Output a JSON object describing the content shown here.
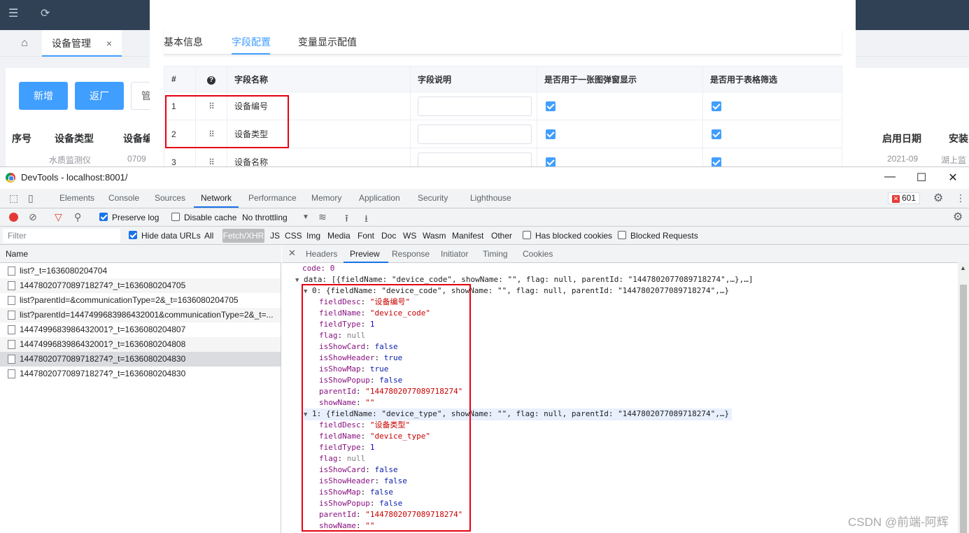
{
  "app": {
    "tab_label": "设备管理",
    "tab_close": "×",
    "buttons": {
      "add": "新增",
      "return": "返厂",
      "manage_partial": "管"
    },
    "columns": {
      "seq": "序号",
      "type": "设备类型",
      "code_partial": "设备编",
      "enable_date": "启用日期",
      "install_partial": "安装"
    },
    "row_partial": {
      "a": "水质监测仪",
      "b": "0709",
      "c": "2021-09",
      "d": "湖上监"
    }
  },
  "modal": {
    "tabs": [
      "基本信息",
      "字段配置",
      "变量显示配值"
    ],
    "active_tab": 1,
    "table": {
      "headers": [
        "#",
        "",
        "字段名称",
        "字段说明",
        "是否用于一张图弹窗显示",
        "是否用于表格筛选"
      ],
      "rows": [
        {
          "index": "1",
          "name": "设备编号"
        },
        {
          "index": "2",
          "name": "设备类型"
        },
        {
          "index": "3",
          "name": "设备名称"
        }
      ]
    }
  },
  "devtools": {
    "title": "DevTools - localhost:8001/",
    "main_tabs": [
      "Elements",
      "Console",
      "Sources",
      "Network",
      "Performance",
      "Memory",
      "Application",
      "Security",
      "Lighthouse"
    ],
    "active_main_tab": "Network",
    "error_count": "601",
    "toolbar": {
      "preserve_log": "Preserve log",
      "disable_cache": "Disable cache",
      "throttling": "No throttling"
    },
    "filter": {
      "placeholder": "Filter",
      "hide_data_urls": "Hide data URLs",
      "types": [
        "All",
        "Fetch/XHR",
        "JS",
        "CSS",
        "Img",
        "Media",
        "Font",
        "Doc",
        "WS",
        "Wasm",
        "Manifest",
        "Other"
      ],
      "active_type": "Fetch/XHR",
      "has_blocked_cookies": "Has blocked cookies",
      "blocked_requests": "Blocked Requests"
    },
    "name_header": "Name",
    "requests": [
      "list?_t=1636080204704",
      "1447802077089718274?_t=1636080204705",
      "list?parentId=&communicationType=2&_t=1636080204705",
      "list?parentId=1447499683986432001&communicationType=2&_t=...",
      "1447499683986432001?_t=1636080204807",
      "1447499683986432001?_t=1636080204808",
      "1447802077089718274?_t=1636080204830",
      "1447802077089718274?_t=1636080204830"
    ],
    "selected_request": 6,
    "detail_tabs": [
      "Headers",
      "Preview",
      "Response",
      "Initiator",
      "Timing",
      "Cookies"
    ],
    "active_detail_tab": "Preview",
    "preview": {
      "code_line": "code: 0",
      "data_line": "data: [{fieldName: \"device_code\", showName: \"\", flag: null, parentId: \"1447802077089718274\",…},…]",
      "items": [
        {
          "summary": "0: {fieldName: \"device_code\", showName: \"\", flag: null, parentId: \"1447802077089718274\",…}",
          "fieldDesc": "\"设备编号\"",
          "fieldName": "\"device_code\"",
          "fieldType": "1",
          "flag": "null",
          "isShowCard": "false",
          "isShowHeader": "true",
          "isShowMap": "true",
          "isShowPopup": "false",
          "parentId": "\"1447802077089718274\"",
          "showName": "\"\""
        },
        {
          "summary": "1: {fieldName: \"device_type\", showName: \"\", flag: null, parentId: \"1447802077089718274\",…}",
          "fieldDesc": "\"设备类型\"",
          "fieldName": "\"device_type\"",
          "fieldType": "1",
          "flag": "null",
          "isShowCard": "false",
          "isShowHeader": "false",
          "isShowMap": "false",
          "isShowPopup": "false",
          "parentId": "\"1447802077089718274\"",
          "showName": "\"\""
        }
      ]
    }
  },
  "watermark": "CSDN @前端-阿辉"
}
